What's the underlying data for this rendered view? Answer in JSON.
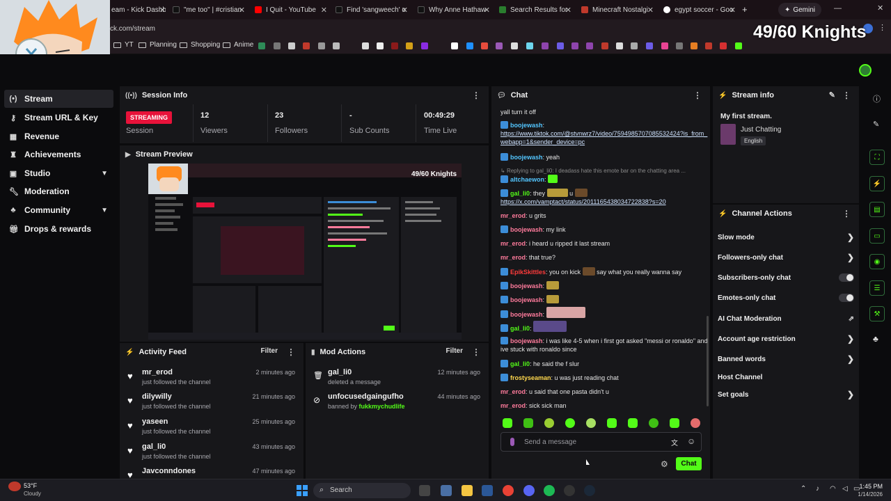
{
  "browser": {
    "tabs": [
      {
        "title": "eam - Kick Dashb",
        "color": "#53fc18"
      },
      {
        "title": "\"me too\" | #cristian",
        "color": "#111111"
      },
      {
        "title": "I Quit - YouTube",
        "color": "#ff0000"
      },
      {
        "title": "Find 'sangweech' o",
        "color": "#111111"
      },
      {
        "title": "Why Anne Hathaw",
        "color": "#111111"
      },
      {
        "title": "Search Results for",
        "color": "#2a7d2e"
      },
      {
        "title": "Minecraft Nostalgi",
        "color": "#c0392b"
      },
      {
        "title": "egypt soccer - Goo",
        "color": "#ffffff"
      }
    ],
    "new_tab": "+",
    "profile_label": "Gemini",
    "url": "ck.com/stream",
    "bookmarks": [
      "YT",
      "Planning",
      "Shopping",
      "Anime"
    ]
  },
  "overlay": {
    "counter": "49/60 Knights"
  },
  "sidebar": {
    "items": [
      {
        "label": "Stream",
        "icon": "broadcast-icon"
      },
      {
        "label": "Stream URL & Key",
        "icon": "key-icon"
      },
      {
        "label": "Revenue",
        "icon": "revenue-icon"
      },
      {
        "label": "Achievements",
        "icon": "trophy-icon"
      },
      {
        "label": "Studio",
        "icon": "studio-icon"
      },
      {
        "label": "Moderation",
        "icon": "wrench-icon"
      },
      {
        "label": "Community",
        "icon": "community-icon"
      },
      {
        "label": "Drops & rewards",
        "icon": "gift-icon"
      }
    ]
  },
  "session": {
    "title": "Session Info",
    "status": "STREAMING",
    "status_label": "Session",
    "viewers": "12",
    "viewers_label": "Viewers",
    "followers": "23",
    "followers_label": "Followers",
    "subs": "-",
    "subs_label": "Sub Counts",
    "time": "00:49:29",
    "time_label": "Time Live"
  },
  "preview": {
    "title": "Stream Preview",
    "counter": "49/60 Knights"
  },
  "activity": {
    "title": "Activity Feed",
    "filter": "Filter",
    "items": [
      {
        "name": "mr_erod",
        "sub": "just followed the channel",
        "time": "2 minutes ago"
      },
      {
        "name": "dilywilly",
        "sub": "just followed the channel",
        "time": "21 minutes ago"
      },
      {
        "name": "yaseen",
        "sub": "just followed the channel",
        "time": "25 minutes ago"
      },
      {
        "name": "gal_li0",
        "sub": "just followed the channel",
        "time": "43 minutes ago"
      },
      {
        "name": "Javconndones",
        "sub": "",
        "time": "47 minutes ago"
      }
    ]
  },
  "mod": {
    "title": "Mod Actions",
    "filter": "Filter",
    "items": [
      {
        "name": "gal_li0",
        "sub": "deleted a message",
        "by": "",
        "time": "12 minutes ago"
      },
      {
        "name": "unfocusedgaingufho",
        "sub": "banned by ",
        "by": "fukkmychudlife",
        "time": "44 minutes ago"
      }
    ]
  },
  "chat": {
    "title": "Chat",
    "messages": [
      {
        "user": "",
        "color": "#e6e6e6",
        "text": "yall turn it off"
      },
      {
        "user": "boojewash",
        "color": "#53c6ff",
        "text": "",
        "link": "https://www.tiktok.com/@stvnwrz7/video/7594985707085532424?is_from_webapp=1&sender_device=pc"
      },
      {
        "user": "boojewash",
        "color": "#53c6ff",
        "text": "yeah"
      },
      {
        "user": "",
        "color": "#888888",
        "text": "Replying to gal_li0: I deadass hate this emote bar on the chatting area ..."
      },
      {
        "user": "altchaewon",
        "color": "#53c6ff",
        "text": ""
      },
      {
        "user": "gal_li0",
        "color": "#53fc18",
        "text": "they",
        "text2": "u",
        "link": "https://x.com/vamptact/status/2011165438034722838?s=20"
      },
      {
        "user": "mr_erod",
        "color": "#ff7b9c",
        "text": "u grits"
      },
      {
        "user": "boojewash",
        "color": "#ff7b9c",
        "text": "my link"
      },
      {
        "user": "mr_erod",
        "color": "#ff7b9c",
        "text": "i heard u ripped it last stream"
      },
      {
        "user": "mr_erod",
        "color": "#ff7b9c",
        "text": "that true?"
      },
      {
        "user": "EpikSkittles",
        "color": "#ff3b3b",
        "text": "you on kick",
        "text2": "say what you really wanna say"
      },
      {
        "user": "boojewash",
        "color": "#ff7b9c",
        "text": ""
      },
      {
        "user": "boojewash",
        "color": "#ff7b9c",
        "text": ""
      },
      {
        "user": "boojewash",
        "color": "#ff7b9c",
        "text": ""
      },
      {
        "user": "gal_li0",
        "color": "#53fc18",
        "text": ""
      },
      {
        "user": "boojewash",
        "color": "#ff7b9c",
        "text": "i was like 4-5 when i first got asked \"messi or ronaldo\" and ive stuck with ronaldo since"
      },
      {
        "user": "gal_li0",
        "color": "#53fc18",
        "text": "he said the f slur"
      },
      {
        "user": "frostyseaman",
        "color": "#ffd84d",
        "text": "u was just reading chat"
      },
      {
        "user": "mr_erod",
        "color": "#ff7b9c",
        "text": "u said that one pasta didn't u"
      },
      {
        "user": "mr_erod",
        "color": "#ff7b9c",
        "text": "sick sick man"
      }
    ],
    "placeholder": "Send a message",
    "send": "Chat"
  },
  "stream_info": {
    "title": "Stream info",
    "stream_title": "My first stream.",
    "category": "Just Chatting",
    "language": "English"
  },
  "channel_actions": {
    "title": "Channel Actions",
    "items": [
      {
        "label": "Slow mode",
        "control": "chevron"
      },
      {
        "label": "Followers-only chat",
        "control": "chevron"
      },
      {
        "label": "Subscribers-only chat",
        "control": "toggle"
      },
      {
        "label": "Emotes-only chat",
        "control": "toggle"
      },
      {
        "label": "AI Chat Moderation",
        "control": "external"
      },
      {
        "label": "Account age restriction",
        "control": "chevron"
      },
      {
        "label": "Banned words",
        "control": "chevron"
      },
      {
        "label": "Host Channel",
        "control": "none"
      },
      {
        "label": "Set goals",
        "control": "chevron"
      }
    ]
  },
  "taskbar": {
    "weather_temp": "53°F",
    "weather_desc": "Cloudy",
    "search_placeholder": "Search",
    "time": "1:45 PM",
    "date": "1/14/2026"
  },
  "colors": {
    "accent": "#53fc18",
    "streaming": "#e8123a",
    "panel": "#17171a"
  }
}
